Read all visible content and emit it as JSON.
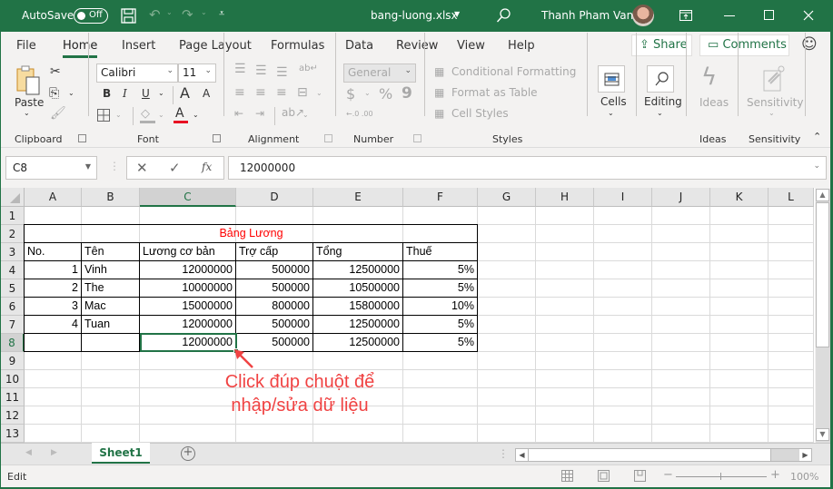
{
  "titlebar": {
    "autosave_label": "AutoSave",
    "autosave_state": "Off",
    "filename": "bang-luong.xlsx",
    "user_name": "Thanh Pham Van"
  },
  "tabs": [
    {
      "label": "File"
    },
    {
      "label": "Home",
      "active": true
    },
    {
      "label": "Insert"
    },
    {
      "label": "Page Layout"
    },
    {
      "label": "Formulas"
    },
    {
      "label": "Data"
    },
    {
      "label": "Review"
    },
    {
      "label": "View"
    },
    {
      "label": "Help"
    }
  ],
  "share_label": "Share",
  "comments_label": "Comments",
  "ribbon": {
    "clipboard": {
      "paste_label": "Paste",
      "group_label": "Clipboard"
    },
    "font": {
      "font_name": "Calibri",
      "font_size": "11",
      "bold": "B",
      "italic": "I",
      "underline": "U",
      "grow": "A",
      "shrink": "A",
      "font_color_glyph": "A",
      "group_label": "Font",
      "font_color": "#e81123"
    },
    "alignment": {
      "group_label": "Alignment"
    },
    "number": {
      "format": "General",
      "currency": "$",
      "percent": "%",
      "comma": "9",
      "inc_dec": "←.0 .00",
      "group_label": "Number"
    },
    "styles": {
      "conditional": "Conditional Formatting",
      "format_table": "Format as Table",
      "cell_styles": "Cell Styles",
      "group_label": "Styles"
    },
    "cells": {
      "label": "Cells"
    },
    "editing": {
      "label": "Editing"
    },
    "ideas": {
      "label": "Ideas",
      "group_label": "Ideas"
    },
    "sensitivity": {
      "label": "Sensitivity",
      "group_label": "Sensitivity"
    }
  },
  "formula_bar": {
    "name_box": "C8",
    "fx": "fx",
    "value": "12000000"
  },
  "columns": [
    "A",
    "B",
    "C",
    "D",
    "E",
    "F",
    "G",
    "H",
    "I",
    "J",
    "K",
    "L"
  ],
  "selected_column": "C",
  "rows": [
    "1",
    "2",
    "3",
    "4",
    "5",
    "6",
    "7",
    "8",
    "9",
    "10",
    "11",
    "12",
    "13"
  ],
  "selected_row": "8",
  "sheet": {
    "title": "Bảng Lương",
    "title_color": "#ff0000",
    "headers": [
      "No.",
      "Tên",
      "Lương cơ bản",
      "Trợ cấp",
      "Tổng",
      "Thuế"
    ],
    "data": [
      [
        "1",
        "Vinh",
        "12000000",
        "500000",
        "12500000",
        "5%"
      ],
      [
        "2",
        "The",
        "10000000",
        "500000",
        "10500000",
        "5%"
      ],
      [
        "3",
        "Mac",
        "15000000",
        "800000",
        "15800000",
        "10%"
      ],
      [
        "4",
        "Tuan",
        "12000000",
        "500000",
        "12500000",
        "5%"
      ],
      [
        "",
        "",
        "12000000",
        "500000",
        "12500000",
        "5%"
      ]
    ]
  },
  "annotation": {
    "line1": "Click đúp chuột để",
    "line2": "nhập/sửa dữ liệu",
    "color": "#f04343"
  },
  "sheet_tabs": [
    {
      "label": "Sheet1",
      "active": true
    }
  ],
  "status": {
    "mode": "Edit",
    "zoom": "100%"
  },
  "accent_color": "#217346"
}
